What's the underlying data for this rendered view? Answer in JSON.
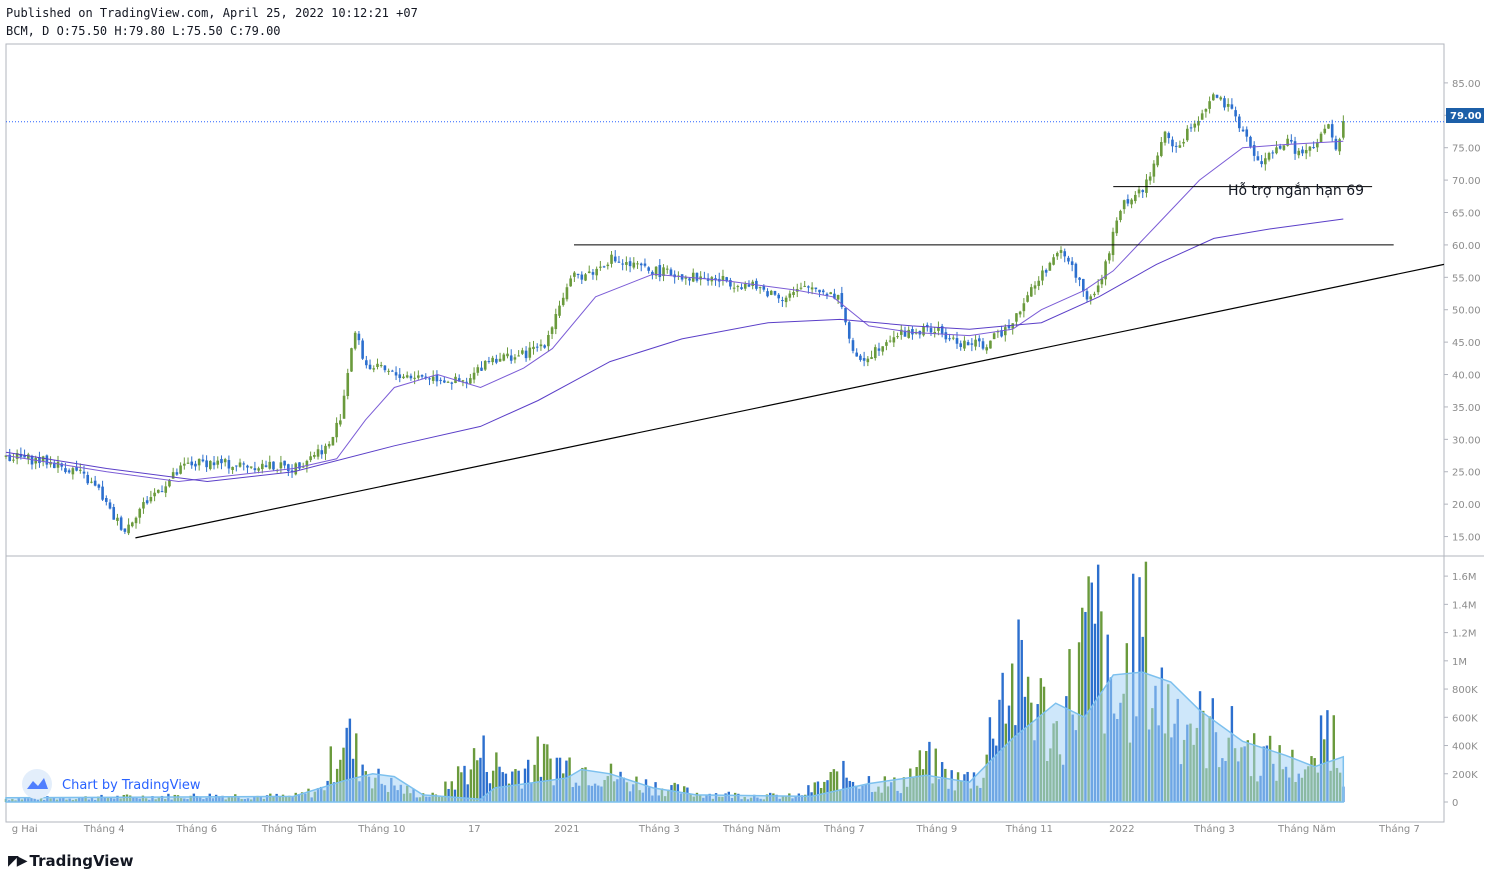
{
  "header": {
    "published": "Published on TradingView.com, April 25, 2022 10:12:21 +07",
    "ohlc": "BCM, D O:75.50 H:79.80 L:75.50 C:79.00"
  },
  "brand": {
    "footer_logo": "TradingView",
    "watermark": "Chart by TradingView",
    "icon": "tradingview-logo-icon"
  },
  "colors": {
    "up": "#6a9a3c",
    "down": "#2c6fce",
    "ma_short": "#7b5cd6",
    "ma_long": "#5b3fc8",
    "volume_ma_fill": "#a6d4f5",
    "price_badge": "#1c5fa8",
    "last_line": "#2962ff"
  },
  "chart_data": [
    {
      "type": "candlestick",
      "symbol": "BCM",
      "interval": "D",
      "last_price": 79.0,
      "ohlc_last": {
        "open": 75.5,
        "high": 79.8,
        "low": 75.5,
        "close": 79.0
      },
      "price_label": "79.00",
      "y_ticks": [
        "85.00",
        "80.00",
        "75.00",
        "70.00",
        "65.00",
        "60.00",
        "55.00",
        "50.00",
        "45.00",
        "40.00",
        "35.00",
        "30.00",
        "25.00",
        "20.00",
        "15.00"
      ],
      "ylim": [
        12,
        91
      ],
      "x_labels": [
        "g Hai",
        "Tháng 4",
        "Tháng 6",
        "Tháng Tám",
        "Tháng 10",
        "17",
        "2021",
        "Tháng 3",
        "Tháng Năm",
        "Tháng 7",
        "Tháng 9",
        "Tháng 11",
        "2022",
        "Tháng 3",
        "Tháng Năm",
        "Tháng 7"
      ],
      "close_series": [
        {
          "t": 0,
          "v": 27.5
        },
        {
          "t": 0.03,
          "v": 26.5
        },
        {
          "t": 0.05,
          "v": 25.0
        },
        {
          "t": 0.065,
          "v": 22.0
        },
        {
          "t": 0.073,
          "v": 18.5
        },
        {
          "t": 0.083,
          "v": 16.0
        },
        {
          "t": 0.09,
          "v": 18.5
        },
        {
          "t": 0.1,
          "v": 21.0
        },
        {
          "t": 0.11,
          "v": 23.0
        },
        {
          "t": 0.125,
          "v": 26.0
        },
        {
          "t": 0.14,
          "v": 26.5
        },
        {
          "t": 0.16,
          "v": 26.0
        },
        {
          "t": 0.18,
          "v": 26.0
        },
        {
          "t": 0.2,
          "v": 25.5
        },
        {
          "t": 0.215,
          "v": 28.0
        },
        {
          "t": 0.225,
          "v": 29.0
        },
        {
          "t": 0.233,
          "v": 34.0
        },
        {
          "t": 0.238,
          "v": 41.0
        },
        {
          "t": 0.242,
          "v": 47.0
        },
        {
          "t": 0.25,
          "v": 41.5
        },
        {
          "t": 0.27,
          "v": 40.0
        },
        {
          "t": 0.3,
          "v": 39.5
        },
        {
          "t": 0.32,
          "v": 38.5
        },
        {
          "t": 0.335,
          "v": 42.5
        },
        {
          "t": 0.36,
          "v": 43.0
        },
        {
          "t": 0.375,
          "v": 45.0
        },
        {
          "t": 0.385,
          "v": 51.0
        },
        {
          "t": 0.395,
          "v": 55.0
        },
        {
          "t": 0.41,
          "v": 56.0
        },
        {
          "t": 0.42,
          "v": 58.0
        },
        {
          "t": 0.43,
          "v": 57.0
        },
        {
          "t": 0.45,
          "v": 56.0
        },
        {
          "t": 0.48,
          "v": 55.0
        },
        {
          "t": 0.5,
          "v": 54.5
        },
        {
          "t": 0.52,
          "v": 53.5
        },
        {
          "t": 0.54,
          "v": 52.0
        },
        {
          "t": 0.56,
          "v": 53.5
        },
        {
          "t": 0.58,
          "v": 52.0
        },
        {
          "t": 0.585,
          "v": 47.0
        },
        {
          "t": 0.59,
          "v": 42.0
        },
        {
          "t": 0.6,
          "v": 43.0
        },
        {
          "t": 0.615,
          "v": 46.0
        },
        {
          "t": 0.63,
          "v": 46.5
        },
        {
          "t": 0.645,
          "v": 47.0
        },
        {
          "t": 0.66,
          "v": 45.0
        },
        {
          "t": 0.68,
          "v": 44.5
        },
        {
          "t": 0.69,
          "v": 46.0
        },
        {
          "t": 0.7,
          "v": 48.5
        },
        {
          "t": 0.71,
          "v": 52.0
        },
        {
          "t": 0.725,
          "v": 57.0
        },
        {
          "t": 0.735,
          "v": 59.0
        },
        {
          "t": 0.745,
          "v": 55.0
        },
        {
          "t": 0.755,
          "v": 51.0
        },
        {
          "t": 0.765,
          "v": 57.0
        },
        {
          "t": 0.775,
          "v": 66.0
        },
        {
          "t": 0.785,
          "v": 67.5
        },
        {
          "t": 0.795,
          "v": 70.0
        },
        {
          "t": 0.805,
          "v": 77.0
        },
        {
          "t": 0.815,
          "v": 75.0
        },
        {
          "t": 0.83,
          "v": 80.0
        },
        {
          "t": 0.84,
          "v": 83.0
        },
        {
          "t": 0.85,
          "v": 81.0
        },
        {
          "t": 0.86,
          "v": 78.0
        },
        {
          "t": 0.87,
          "v": 72.5
        },
        {
          "t": 0.88,
          "v": 74.0
        },
        {
          "t": 0.89,
          "v": 76.0
        },
        {
          "t": 0.9,
          "v": 74.0
        },
        {
          "t": 0.91,
          "v": 75.0
        },
        {
          "t": 0.92,
          "v": 78.5
        },
        {
          "t": 0.925,
          "v": 74.0
        },
        {
          "t": 0.93,
          "v": 79.0
        }
      ],
      "moving_averages": [
        {
          "points": [
            {
              "t": 0,
              "v": 27.5
            },
            {
              "t": 0.07,
              "v": 25.0
            },
            {
              "t": 0.12,
              "v": 23.5
            },
            {
              "t": 0.16,
              "v": 24.5
            },
            {
              "t": 0.2,
              "v": 25.5
            },
            {
              "t": 0.23,
              "v": 27.0
            },
            {
              "t": 0.25,
              "v": 33.0
            },
            {
              "t": 0.27,
              "v": 38.0
            },
            {
              "t": 0.3,
              "v": 40.0
            },
            {
              "t": 0.33,
              "v": 38.0
            },
            {
              "t": 0.36,
              "v": 41.0
            },
            {
              "t": 0.38,
              "v": 44.0
            },
            {
              "t": 0.41,
              "v": 52.0
            },
            {
              "t": 0.45,
              "v": 55.5
            },
            {
              "t": 0.5,
              "v": 54.5
            },
            {
              "t": 0.55,
              "v": 53.0
            },
            {
              "t": 0.575,
              "v": 52.0
            },
            {
              "t": 0.6,
              "v": 47.5
            },
            {
              "t": 0.63,
              "v": 46.5
            },
            {
              "t": 0.67,
              "v": 46.0
            },
            {
              "t": 0.7,
              "v": 47.0
            },
            {
              "t": 0.72,
              "v": 50.0
            },
            {
              "t": 0.75,
              "v": 53.0
            },
            {
              "t": 0.77,
              "v": 56.0
            },
            {
              "t": 0.8,
              "v": 63.0
            },
            {
              "t": 0.83,
              "v": 70.0
            },
            {
              "t": 0.86,
              "v": 75.0
            },
            {
              "t": 0.89,
              "v": 75.5
            },
            {
              "t": 0.93,
              "v": 76.0
            }
          ]
        },
        {
          "points": [
            {
              "t": 0,
              "v": 28.0
            },
            {
              "t": 0.07,
              "v": 25.5
            },
            {
              "t": 0.14,
              "v": 23.5
            },
            {
              "t": 0.2,
              "v": 25.0
            },
            {
              "t": 0.27,
              "v": 29.0
            },
            {
              "t": 0.33,
              "v": 32.0
            },
            {
              "t": 0.37,
              "v": 36.0
            },
            {
              "t": 0.42,
              "v": 42.0
            },
            {
              "t": 0.47,
              "v": 45.5
            },
            {
              "t": 0.53,
              "v": 48.0
            },
            {
              "t": 0.58,
              "v": 48.5
            },
            {
              "t": 0.63,
              "v": 47.5
            },
            {
              "t": 0.67,
              "v": 47.0
            },
            {
              "t": 0.72,
              "v": 48.0
            },
            {
              "t": 0.76,
              "v": 52.0
            },
            {
              "t": 0.8,
              "v": 57.0
            },
            {
              "t": 0.84,
              "v": 61.0
            },
            {
              "t": 0.88,
              "v": 62.5
            },
            {
              "t": 0.93,
              "v": 64.0
            }
          ]
        }
      ],
      "support_lines": [
        {
          "label": "Hỗ trợ ngắn hạn 69",
          "value": 69,
          "t_start": 0.77,
          "t_end": 0.95
        },
        {
          "label": "",
          "value": 60,
          "t_start": 0.395,
          "t_end": 0.965
        }
      ],
      "trendline": {
        "t_start": 0.09,
        "v_start": 14.8,
        "t_end": 1.0,
        "v_end": 57.0
      }
    },
    {
      "type": "bar",
      "name": "volume",
      "y_ticks": [
        "1.6M",
        "1.4M",
        "1.2M",
        "1M",
        "800K",
        "600K",
        "400K",
        "200K",
        "0"
      ],
      "ylim": [
        0,
        1700000
      ],
      "volume_series": [
        {
          "t": 0,
          "v": 30000
        },
        {
          "t": 0.05,
          "v": 40000
        },
        {
          "t": 0.1,
          "v": 50000
        },
        {
          "t": 0.15,
          "v": 60000
        },
        {
          "t": 0.2,
          "v": 50000
        },
        {
          "t": 0.22,
          "v": 120000
        },
        {
          "t": 0.235,
          "v": 680000
        },
        {
          "t": 0.245,
          "v": 400000
        },
        {
          "t": 0.26,
          "v": 200000
        },
        {
          "t": 0.28,
          "v": 100000
        },
        {
          "t": 0.3,
          "v": 50000
        },
        {
          "t": 0.33,
          "v": 450000
        },
        {
          "t": 0.35,
          "v": 250000
        },
        {
          "t": 0.37,
          "v": 400000
        },
        {
          "t": 0.39,
          "v": 350000
        },
        {
          "t": 0.41,
          "v": 300000
        },
        {
          "t": 0.43,
          "v": 200000
        },
        {
          "t": 0.48,
          "v": 80000
        },
        {
          "t": 0.52,
          "v": 60000
        },
        {
          "t": 0.55,
          "v": 50000
        },
        {
          "t": 0.58,
          "v": 250000
        },
        {
          "t": 0.6,
          "v": 200000
        },
        {
          "t": 0.62,
          "v": 150000
        },
        {
          "t": 0.64,
          "v": 380000
        },
        {
          "t": 0.66,
          "v": 200000
        },
        {
          "t": 0.68,
          "v": 250000
        },
        {
          "t": 0.69,
          "v": 1100000
        },
        {
          "t": 0.71,
          "v": 1100000
        },
        {
          "t": 0.73,
          "v": 600000
        },
        {
          "t": 0.75,
          "v": 1450000
        },
        {
          "t": 0.76,
          "v": 1600000
        },
        {
          "t": 0.77,
          "v": 700000
        },
        {
          "t": 0.78,
          "v": 1200000
        },
        {
          "t": 0.79,
          "v": 1650000
        },
        {
          "t": 0.8,
          "v": 1000000
        },
        {
          "t": 0.81,
          "v": 900000
        },
        {
          "t": 0.83,
          "v": 700000
        },
        {
          "t": 0.85,
          "v": 600000
        },
        {
          "t": 0.87,
          "v": 450000
        },
        {
          "t": 0.89,
          "v": 350000
        },
        {
          "t": 0.91,
          "v": 300000
        },
        {
          "t": 0.92,
          "v": 780000
        },
        {
          "t": 0.93,
          "v": 300000
        }
      ],
      "volume_ma": [
        {
          "t": 0,
          "v": 30000
        },
        {
          "t": 0.2,
          "v": 40000
        },
        {
          "t": 0.235,
          "v": 150000
        },
        {
          "t": 0.255,
          "v": 200000
        },
        {
          "t": 0.27,
          "v": 180000
        },
        {
          "t": 0.29,
          "v": 50000
        },
        {
          "t": 0.33,
          "v": 20000
        },
        {
          "t": 0.34,
          "v": 100000
        },
        {
          "t": 0.39,
          "v": 170000
        },
        {
          "t": 0.4,
          "v": 230000
        },
        {
          "t": 0.42,
          "v": 200000
        },
        {
          "t": 0.45,
          "v": 100000
        },
        {
          "t": 0.48,
          "v": 50000
        },
        {
          "t": 0.56,
          "v": 40000
        },
        {
          "t": 0.6,
          "v": 130000
        },
        {
          "t": 0.64,
          "v": 190000
        },
        {
          "t": 0.67,
          "v": 140000
        },
        {
          "t": 0.7,
          "v": 450000
        },
        {
          "t": 0.73,
          "v": 700000
        },
        {
          "t": 0.75,
          "v": 600000
        },
        {
          "t": 0.77,
          "v": 900000
        },
        {
          "t": 0.79,
          "v": 920000
        },
        {
          "t": 0.81,
          "v": 850000
        },
        {
          "t": 0.83,
          "v": 650000
        },
        {
          "t": 0.86,
          "v": 430000
        },
        {
          "t": 0.89,
          "v": 330000
        },
        {
          "t": 0.91,
          "v": 250000
        },
        {
          "t": 0.93,
          "v": 320000
        }
      ]
    }
  ]
}
